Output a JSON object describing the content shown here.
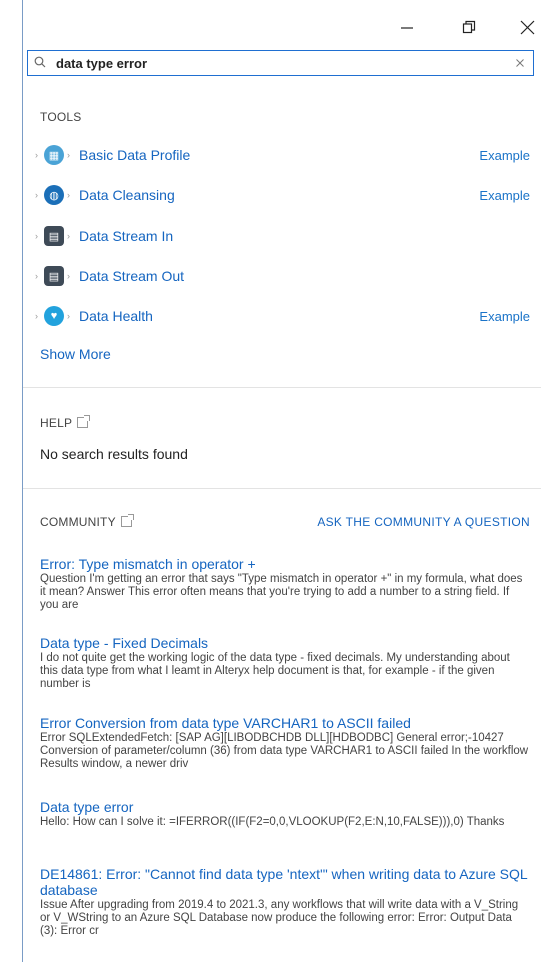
{
  "window": {
    "minimize_icon": "minimize-icon",
    "maximize_icon": "restore-icon",
    "close_icon": "close-icon"
  },
  "search": {
    "value": "data type error",
    "icon": "search-icon",
    "clear_icon": "close-icon"
  },
  "tools": {
    "heading": "TOOLS",
    "items": [
      {
        "name": "Basic Data Profile",
        "example": "Example",
        "icon": "data-profile-icon",
        "color": "#4aa3d6"
      },
      {
        "name": "Data Cleansing",
        "example": "Example",
        "icon": "data-cleansing-icon",
        "color": "#1b6fb8"
      },
      {
        "name": "Data Stream In",
        "example": "",
        "icon": "data-stream-in-icon",
        "color": "#3e4a57"
      },
      {
        "name": "Data Stream Out",
        "example": "",
        "icon": "data-stream-out-icon",
        "color": "#3e4a57"
      },
      {
        "name": "Data Health",
        "example": "Example",
        "icon": "data-health-icon",
        "color": "#22a2dd"
      }
    ],
    "show_more": "Show More"
  },
  "help": {
    "heading": "HELP",
    "message": "No search results found"
  },
  "community": {
    "heading": "COMMUNITY",
    "ask_label": "ASK THE COMMUNITY A QUESTION",
    "results": [
      {
        "title": "Error: Type mismatch in operator +",
        "snippet": "Question I'm getting an error that says \"Type mismatch in operator +\" in my formula, what does it mean? Answer This error often means that you're trying to add a number to a string field. If you are"
      },
      {
        "title": "Data type - Fixed Decimals",
        "snippet": "I do not quite get the working logic of the data type - fixed decimals. My understanding about this data type from what I leamt in Alteryx help document is that, for example - if the given number is"
      },
      {
        "title": "Error Conversion from data type VARCHAR1 to ASCII failed",
        "snippet": "Error SQLExtendedFetch: [SAP AG][LIBODBCHDB DLL][HDBODBC] General error;-10427 Conversion of parameter/column (36) from data type VARCHAR1 to ASCII failed In the workflow Results window, a newer driv"
      },
      {
        "title": "Data type error",
        "snippet": "Hello: How can I solve it: =IFERROR((IF(F2=0,0,VLOOKUP(F2,E:N,10,FALSE))),0) Thanks"
      },
      {
        "title": "DE14861: Error: \"Cannot find data type 'ntext'\" when writing data to Azure SQL database",
        "snippet": "Issue After upgrading from 2019.4 to 2021.3, any workflows that will write data with a V_String or V_WString to an Azure SQL Database now produce the following error: Error: Output Data (3): Error cr"
      }
    ]
  }
}
